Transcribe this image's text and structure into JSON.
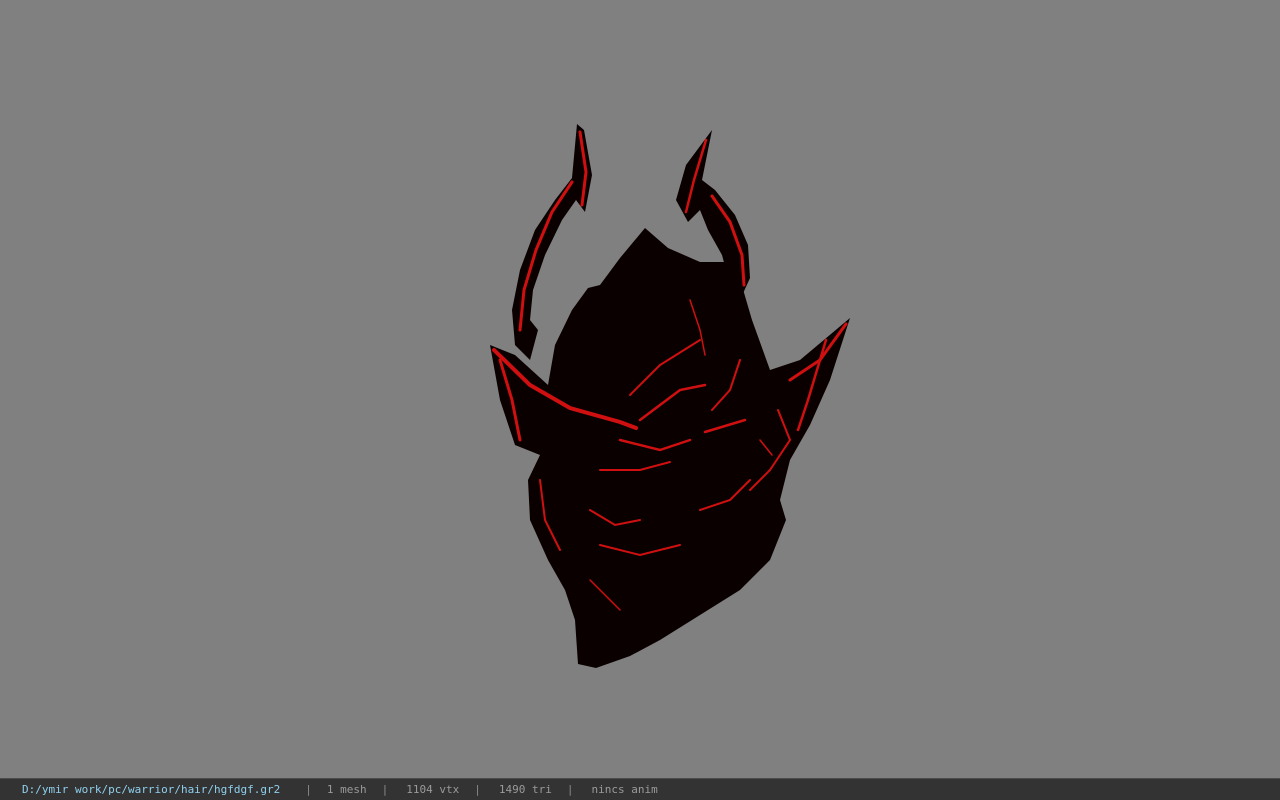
{
  "viewport": {
    "background_color": "#808080",
    "model_colors": {
      "base": "#0a0000",
      "highlight": "#e01010"
    }
  },
  "statusbar": {
    "file_path": "D:/ymir work/pc/warrior/hair/hgfdgf.gr2",
    "separator": "|",
    "mesh_count": "1 mesh",
    "vertex_count": "1104 vtx",
    "triangle_count": "1490 tri",
    "anim_status": "nincs anim",
    "path_color": "#8ed0ee",
    "text_color": "#9a9a9a"
  }
}
